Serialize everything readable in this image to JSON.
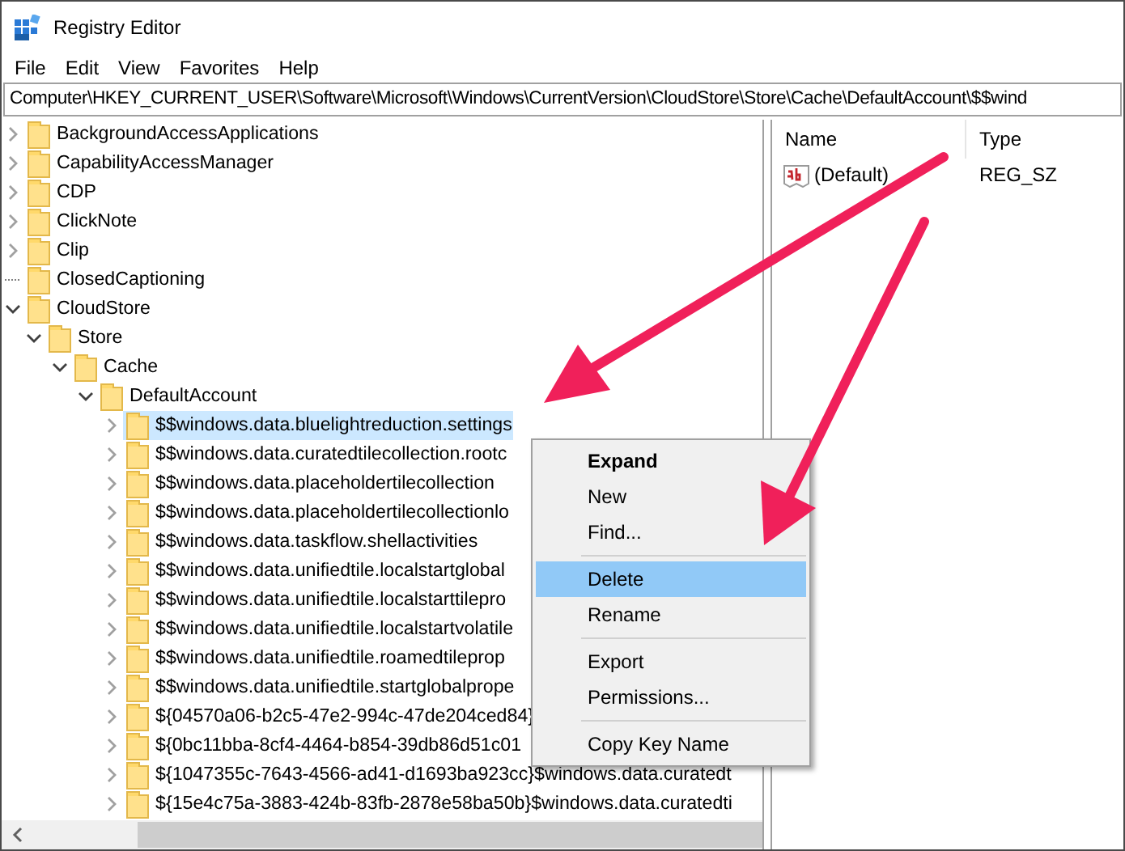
{
  "window": {
    "title": "Registry Editor"
  },
  "menu_bar": [
    "File",
    "Edit",
    "View",
    "Favorites",
    "Help"
  ],
  "address_bar": "Computer\\HKEY_CURRENT_USER\\Software\\Microsoft\\Windows\\CurrentVersion\\CloudStore\\Store\\Cache\\DefaultAccount\\$$wind",
  "tree": [
    {
      "label": "BackgroundAccessApplications",
      "kind": "branch",
      "expanded": false,
      "selected": false
    },
    {
      "label": "CapabilityAccessManager",
      "kind": "branch",
      "expanded": false,
      "selected": false
    },
    {
      "label": "CDP",
      "kind": "branch",
      "expanded": false,
      "selected": false
    },
    {
      "label": "ClickNote",
      "kind": "branch",
      "expanded": false,
      "selected": false
    },
    {
      "label": "Clip",
      "kind": "branch",
      "expanded": false,
      "selected": false
    },
    {
      "label": "ClosedCaptioning",
      "kind": "leaf",
      "selected": false
    },
    {
      "label": "CloudStore",
      "kind": "branch",
      "expanded": true,
      "selected": false,
      "children": [
        {
          "label": "Store",
          "kind": "branch",
          "expanded": true,
          "selected": false,
          "children": [
            {
              "label": "Cache",
              "kind": "branch",
              "expanded": true,
              "selected": false,
              "children": [
                {
                  "label": "DefaultAccount",
                  "kind": "branch",
                  "expanded": true,
                  "selected": false,
                  "children": [
                    {
                      "label": "$$windows.data.bluelightreduction.settings",
                      "kind": "branch",
                      "expanded": false,
                      "selected": true
                    },
                    {
                      "label": "$$windows.data.curatedtilecollection.rootc",
                      "kind": "branch",
                      "expanded": false,
                      "selected": false
                    },
                    {
                      "label": "$$windows.data.placeholdertilecollection",
                      "kind": "branch",
                      "expanded": false,
                      "selected": false
                    },
                    {
                      "label": "$$windows.data.placeholdertilecollectionlo",
                      "kind": "branch",
                      "expanded": false,
                      "selected": false
                    },
                    {
                      "label": "$$windows.data.taskflow.shellactivities",
                      "kind": "branch",
                      "expanded": false,
                      "selected": false
                    },
                    {
                      "label": "$$windows.data.unifiedtile.localstartglobal",
                      "kind": "branch",
                      "expanded": false,
                      "selected": false
                    },
                    {
                      "label": "$$windows.data.unifiedtile.localstarttilepro",
                      "kind": "branch",
                      "expanded": false,
                      "selected": false
                    },
                    {
                      "label": "$$windows.data.unifiedtile.localstartvolatile",
                      "kind": "branch",
                      "expanded": false,
                      "selected": false
                    },
                    {
                      "label": "$$windows.data.unifiedtile.roamedtileprop",
                      "kind": "branch",
                      "expanded": false,
                      "selected": false
                    },
                    {
                      "label": "$$windows.data.unifiedtile.startglobalprope",
                      "kind": "branch",
                      "expanded": false,
                      "selected": false
                    },
                    {
                      "label": "${04570a06-b2c5-47e2-994c-47de204ced84}",
                      "kind": "branch",
                      "expanded": false,
                      "selected": false
                    },
                    {
                      "label": "${0bc11bba-8cf4-4464-b854-39db86d51c01",
                      "kind": "branch",
                      "expanded": false,
                      "selected": false
                    },
                    {
                      "label": "${1047355c-7643-4566-ad41-d1693ba923cc}$windows.data.curatedt",
                      "kind": "branch",
                      "expanded": false,
                      "selected": false
                    },
                    {
                      "label": "${15e4c75a-3883-424b-83fb-2878e58ba50b}$windows.data.curatedti",
                      "kind": "branch",
                      "expanded": false,
                      "selected": false
                    }
                  ]
                }
              ]
            }
          ]
        }
      ]
    }
  ],
  "values": {
    "columns": [
      "Name",
      "Type"
    ],
    "rows": [
      {
        "name": "(Default)",
        "type": "REG_SZ"
      }
    ]
  },
  "context_menu": [
    {
      "kind": "item",
      "label": "Expand",
      "default": true,
      "selected": false
    },
    {
      "kind": "item",
      "label": "New",
      "default": false,
      "selected": false
    },
    {
      "kind": "item",
      "label": "Find...",
      "default": false,
      "selected": false
    },
    {
      "kind": "separator"
    },
    {
      "kind": "item",
      "label": "Delete",
      "default": false,
      "selected": true
    },
    {
      "kind": "item",
      "label": "Rename",
      "default": false,
      "selected": false
    },
    {
      "kind": "separator"
    },
    {
      "kind": "item",
      "label": "Export",
      "default": false,
      "selected": false
    },
    {
      "kind": "item",
      "label": "Permissions...",
      "default": false,
      "selected": false
    },
    {
      "kind": "separator"
    },
    {
      "kind": "item",
      "label": "Copy Key Name",
      "default": false,
      "selected": false
    }
  ]
}
